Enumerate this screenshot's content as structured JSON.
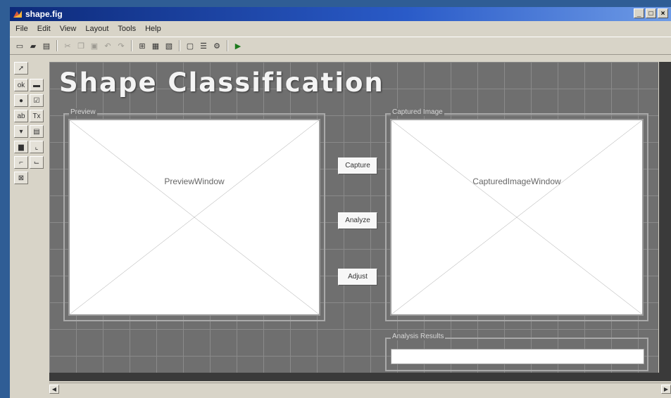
{
  "window": {
    "title": "shape.fig",
    "minimize": "_",
    "maximize": "□",
    "close": "×"
  },
  "menu": [
    "File",
    "Edit",
    "View",
    "Layout",
    "Tools",
    "Help"
  ],
  "toolbar": {
    "icons": [
      "new-icon",
      "open-icon",
      "save-icon",
      "cut-icon",
      "copy-icon",
      "paste-icon",
      "undo-icon",
      "redo-icon",
      "align-icon",
      "editor-icon",
      "property-icon",
      "browser-icon",
      "tab-order-icon",
      "menu-editor-icon",
      "run-icon"
    ]
  },
  "palette": {
    "tools": [
      "select",
      "push-button",
      "slider",
      "radio-button",
      "checkbox",
      "edit-text",
      "static-text",
      "popup-menu",
      "listbox",
      "toggle-button",
      "axes",
      "panel",
      "button-group",
      "activex"
    ]
  },
  "canvas": {
    "heading": "Shape Classification",
    "preview_panel": {
      "label": "Preview",
      "axes_label": "PreviewWindow"
    },
    "captured_panel": {
      "label": "Captured Image",
      "axes_label": "CapturedImageWindow"
    },
    "buttons": {
      "capture": "Capture",
      "analyze": "Analyze",
      "adjust": "Adjust"
    },
    "results_panel": {
      "label": "Analysis Results",
      "value": ""
    }
  },
  "colors": {
    "titlebar": "#0d2a7a",
    "canvas": "#6f6f6f",
    "desktop": "#2f5d95"
  }
}
